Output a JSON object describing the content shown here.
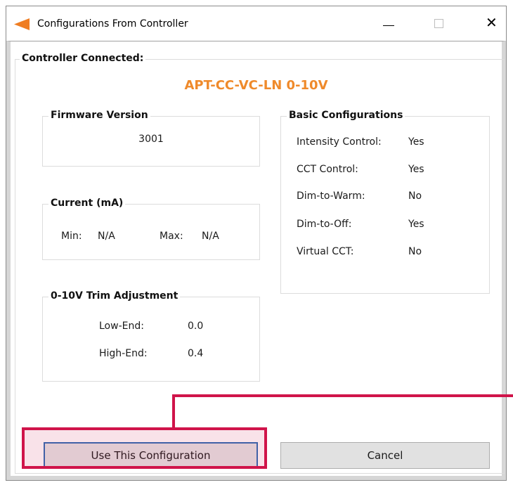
{
  "window": {
    "title": "Configurations From Controller",
    "controls": {
      "minimize": "—",
      "maximize": "☐",
      "close": "✕"
    }
  },
  "status": {
    "label": "Controller Connected:",
    "device_name": "APT-CC-VC-LN 0-10V",
    "device_name_color": "#ef8a2b"
  },
  "firmware": {
    "title": "Firmware Version",
    "value": "3001"
  },
  "current": {
    "title": "Current (mA)",
    "min_label": "Min:",
    "min_value": "N/A",
    "max_label": "Max:",
    "max_value": "N/A"
  },
  "trim": {
    "title": "0-10V Trim Adjustment",
    "low_label": "Low-End:",
    "low_value": "0.0",
    "high_label": "High-End:",
    "high_value": "0.4"
  },
  "basic": {
    "title": "Basic Configurations",
    "items": [
      {
        "label": "Intensity Control:",
        "value": "Yes"
      },
      {
        "label": "CCT Control:",
        "value": "Yes"
      },
      {
        "label": "Dim-to-Warm:",
        "value": "No"
      },
      {
        "label": "Dim-to-Off:",
        "value": "Yes"
      },
      {
        "label": "Virtual CCT:",
        "value": "No"
      }
    ]
  },
  "buttons": {
    "use": "Use This Configuration",
    "cancel": "Cancel"
  },
  "annotation": {
    "highlight_color": "#d0144a"
  },
  "icons": {
    "app": "orange-arrow-icon"
  }
}
